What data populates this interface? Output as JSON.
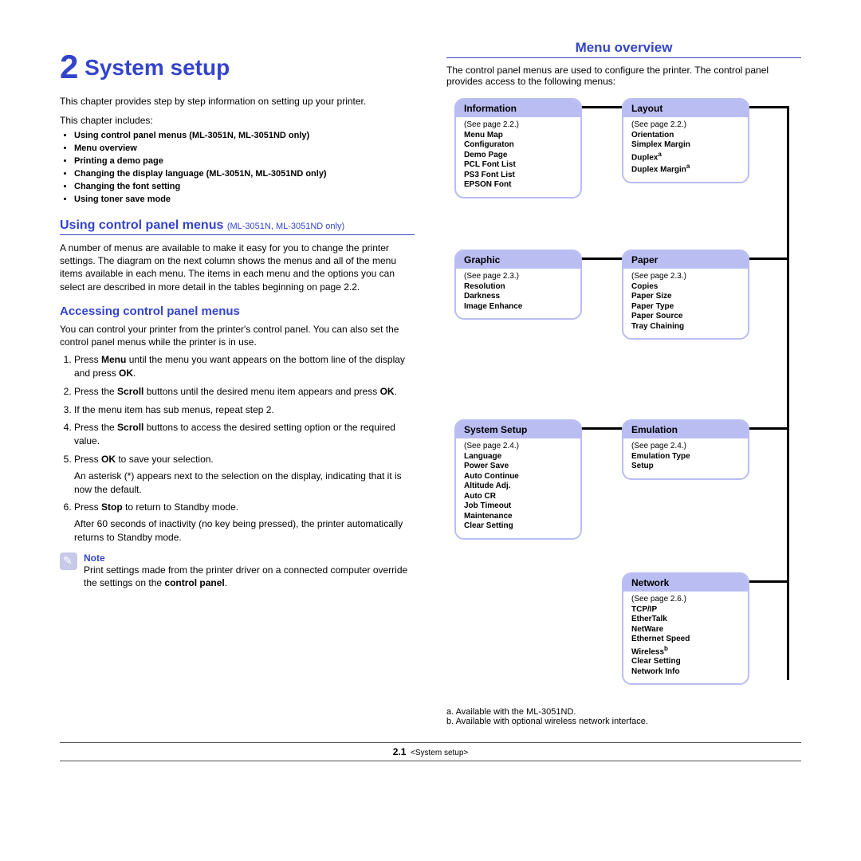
{
  "chapter": {
    "number": "2",
    "title": "System setup"
  },
  "intro": "This chapter provides step by step information on setting up your printer.",
  "includes_label": "This chapter includes:",
  "toc": [
    "Using control panel menus (ML-3051N, ML-3051ND only)",
    "Menu overview",
    "Printing a demo page",
    "Changing the display language (ML-3051N, ML-3051ND only)",
    "Changing the font setting",
    "Using toner save mode"
  ],
  "section1": {
    "title": "Using control panel menus",
    "sub": "(ML-3051N, ML-3051ND only)",
    "para": "A number of menus are available to make it easy for you to change the printer settings. The diagram on the next column shows the menus and all of the menu items available in each menu. The items in each menu and the options you can select are described in more detail in the tables beginning on page 2.2."
  },
  "accessing": {
    "title": "Accessing control panel menus",
    "intro": "You can control your printer from the printer's control panel. You can also set the control panel menus while the printer is in use.",
    "steps": [
      {
        "main": "Press <b>Menu</b> until the menu you want appears on the bottom line of the display and press <b>OK</b>."
      },
      {
        "main": "Press the <b>Scroll</b> buttons until the desired menu item appears and press <b>OK</b>."
      },
      {
        "main": "If the menu item has sub menus, repeat step 2."
      },
      {
        "main": "Press the <b>Scroll</b> buttons to access the desired setting option or the required value."
      },
      {
        "main": "Press <b>OK</b> to save your selection.",
        "extra": "An asterisk (*) appears next to the selection on the display, indicating that it is now the default."
      },
      {
        "main": "Press <b>Stop</b> to return to Standby mode.",
        "extra": "After 60 seconds of inactivity (no key being pressed), the printer automatically returns to Standby mode."
      }
    ],
    "note_label": "Note",
    "note_text": "Print settings made from the printer driver on a connected computer override the settings on the <b>control panel</b>."
  },
  "menu_overview": {
    "title": "Menu overview",
    "intro": "The control panel menus are used to configure the printer. The control panel provides access to the following menus:",
    "boxes": {
      "information": {
        "title": "Information",
        "see": "(See page 2.2.)",
        "items": [
          "Menu Map",
          "Configuraton",
          "Demo Page",
          "PCL Font List",
          "PS3 Font List",
          "EPSON Font"
        ]
      },
      "layout": {
        "title": "Layout",
        "see": "(See page 2.2.)",
        "items": [
          "Orientation",
          "Simplex Margin",
          "Duplex<sup class='sup'>a</sup>",
          "Duplex Margin<sup class='sup'>a</sup>"
        ]
      },
      "graphic": {
        "title": "Graphic",
        "see": "(See page 2.3.)",
        "items": [
          "Resolution",
          "Darkness",
          "Image Enhance"
        ]
      },
      "paper": {
        "title": "Paper",
        "see": "(See page 2.3.)",
        "items": [
          "Copies",
          "Paper Size",
          "Paper Type",
          "Paper Source",
          "Tray Chaining"
        ]
      },
      "system": {
        "title": "System Setup",
        "see": "(See page 2.4.)",
        "items": [
          "Language",
          "Power Save",
          "Auto Continue",
          "Altitude Adj.",
          "Auto CR",
          "Job Timeout",
          "Maintenance",
          "Clear Setting"
        ]
      },
      "emulation": {
        "title": "Emulation",
        "see": "(See page 2.4.)",
        "items": [
          "Emulation Type",
          "Setup"
        ]
      },
      "network": {
        "title": "Network",
        "see": "(See page 2.6.)",
        "items": [
          "TCP/IP",
          "EtherTalk",
          "NetWare",
          "Ethernet Speed",
          "Wireless<sup class='sup'>b</sup>",
          "Clear Setting",
          "Network Info"
        ]
      }
    },
    "footnotes": [
      "a. Available with the ML-3051ND.",
      "b. Available with optional wireless network interface."
    ]
  },
  "footer": {
    "page": "2.1",
    "label": "<System setup>"
  }
}
